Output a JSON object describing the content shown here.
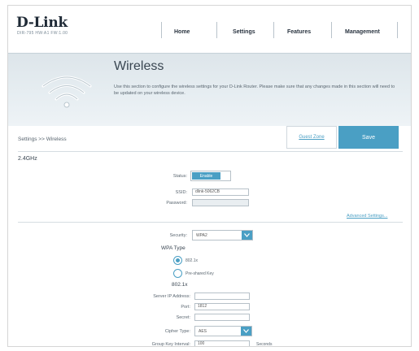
{
  "header": {
    "logo": "D-Link",
    "model": "DIR-795 HW:A1 FW:1.00",
    "nav": [
      "Home",
      "Settings",
      "Features",
      "Management"
    ]
  },
  "banner": {
    "title": "Wireless",
    "description": "Use this section to configure the wireless settings for your D-Link Router. Please make sure that any changes made in this section will need to be updated on your wireless device."
  },
  "toolbar": {
    "breadcrumb": "Settings >> Wireless",
    "guest_zone": "Guest Zone",
    "save": "Save"
  },
  "band": {
    "heading": "2.4GHz",
    "status_label": "Status:",
    "status_value": "Enable",
    "ssid_label": "SSID:",
    "ssid_value": "dlink-5062CB",
    "password_label": "Password:",
    "password_value": "",
    "advanced_link": "Advanced Settings..."
  },
  "security": {
    "label": "Security:",
    "value": "WPA2",
    "wpa_type_heading": "WPA Type",
    "wpa_options": [
      {
        "label": "802.1x",
        "selected": true
      },
      {
        "label": "Pre-shared Key",
        "selected": false
      }
    ]
  },
  "radius": {
    "heading": "802.1x",
    "server_ip_label": "Server IP Address:",
    "server_ip_value": "",
    "port_label": "Port:",
    "port_value": "1812",
    "secret_label": "Secret:",
    "secret_value": "",
    "cipher_label": "Cipher Type:",
    "cipher_value": "AES",
    "group_key_label": "Group Key Interval:",
    "group_key_value": "100",
    "group_key_unit": "Seconds"
  },
  "colors": {
    "accent": "#4a9fc4",
    "banner_bg": "#e3ebf0",
    "text_dark": "#3a4652"
  }
}
